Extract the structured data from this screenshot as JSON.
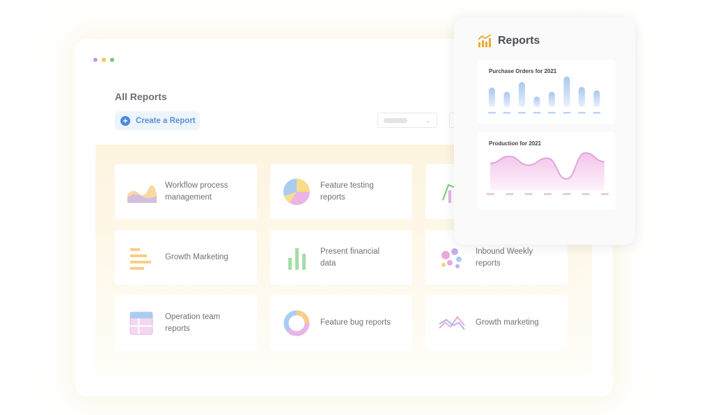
{
  "window": {
    "dots": [
      "#c89ad6",
      "#f2c94c",
      "#7cc47f"
    ],
    "title": "All Reports",
    "create_button": "Create a Report",
    "accent": "#4a88e0"
  },
  "reports": [
    {
      "label": "Workflow process management",
      "icon": "area-chart-icon"
    },
    {
      "label": "Feature testing reports",
      "icon": "pie-chart-icon"
    },
    {
      "label": "",
      "icon": "line-bar-chart-icon"
    },
    {
      "label": "Growth Marketing",
      "icon": "horizontal-bar-icon"
    },
    {
      "label": "Present financial data",
      "icon": "bar-chart-icon"
    },
    {
      "label": "Inbound Weekly reports",
      "icon": "bubble-chart-icon"
    },
    {
      "label": "Operation team reports",
      "icon": "table-icon"
    },
    {
      "label": "Feature bug reports",
      "icon": "donut-chart-icon"
    },
    {
      "label": "Growth marketing",
      "icon": "line-chart-icon"
    }
  ],
  "panel": {
    "title": "Reports",
    "purchase_title": "Purchase Orders for 2021",
    "production_title": "Production for 2021"
  },
  "chart_data": [
    {
      "type": "bar",
      "title": "Purchase Orders for 2021",
      "values": [
        28,
        22,
        36,
        15,
        22,
        44,
        29,
        24
      ],
      "color": "#a9c8f0"
    },
    {
      "type": "area",
      "title": "Production for 2021",
      "values": [
        28,
        36,
        26,
        34,
        10,
        40,
        30
      ],
      "color": "#e9a8da"
    }
  ]
}
